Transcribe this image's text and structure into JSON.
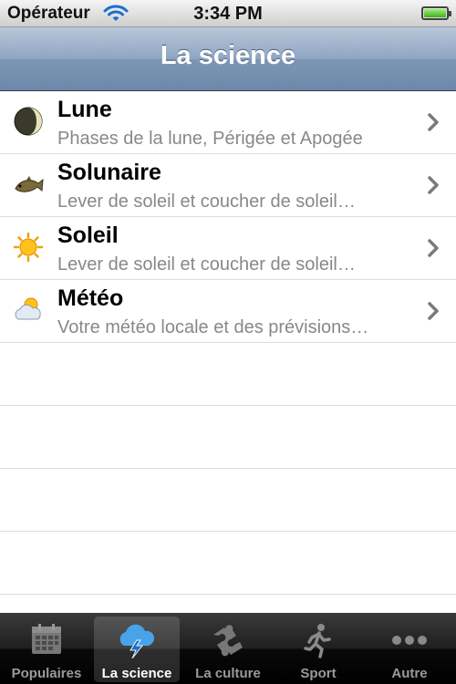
{
  "status_bar": {
    "carrier": "Opérateur",
    "time": "3:34 PM",
    "battery_level": 1.0
  },
  "nav": {
    "title": "La science"
  },
  "rows": [
    {
      "title": "Lune",
      "subtitle": "Phases de la lune, Périgée et Apogée",
      "icon": "moon-icon"
    },
    {
      "title": "Solunaire",
      "subtitle": "Lever de soleil et coucher de soleil…",
      "icon": "fish-icon"
    },
    {
      "title": "Soleil",
      "subtitle": "Lever de soleil et coucher de soleil…",
      "icon": "sun-icon"
    },
    {
      "title": "Météo",
      "subtitle": "Votre météo locale et des prévisions…",
      "icon": "cloud-sun-icon"
    }
  ],
  "tabs": [
    {
      "label": "Populaires",
      "icon": "calendar-icon",
      "selected": false
    },
    {
      "label": "La science",
      "icon": "cloud-lightning-icon",
      "selected": true
    },
    {
      "label": "La culture",
      "icon": "puzzle-icon",
      "selected": false
    },
    {
      "label": "Sport",
      "icon": "runner-icon",
      "selected": false
    },
    {
      "label": "Autre",
      "icon": "more-icon",
      "selected": false
    }
  ],
  "colors": {
    "nav_bar": "#7d96b5",
    "tab_active_icon": "#4aa3e8",
    "subtitle": "#888888"
  }
}
